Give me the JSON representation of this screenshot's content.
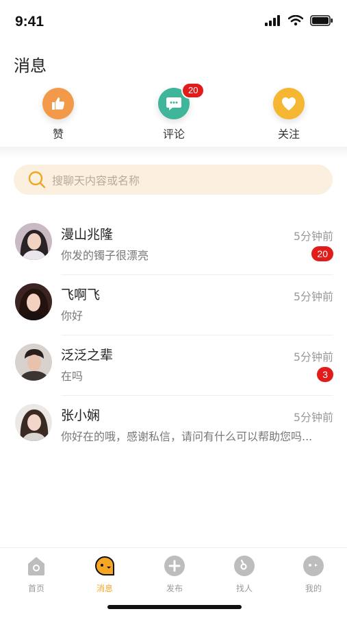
{
  "status_bar": {
    "time": "9:41"
  },
  "page": {
    "title": "消息"
  },
  "categories": [
    {
      "label": "赞",
      "icon": "thumbs-up-icon"
    },
    {
      "label": "评论",
      "icon": "comment-icon",
      "badge": "20"
    },
    {
      "label": "关注",
      "icon": "heart-icon"
    }
  ],
  "search": {
    "placeholder": "搜聊天内容或名称"
  },
  "chats": [
    {
      "name": "漫山兆隆",
      "message": "你发的镯子很漂亮",
      "time": "5分钟前",
      "unread": "20"
    },
    {
      "name": "飞啊飞",
      "message": "你好",
      "time": "5分钟前"
    },
    {
      "name": "泛泛之辈",
      "message": "在吗",
      "time": "5分钟前",
      "unread": "3"
    },
    {
      "name": "张小娴",
      "message": "你好在的哦，感谢私信，请问有什么可以帮助您吗...",
      "time": "5分钟前"
    }
  ],
  "tabbar": [
    {
      "label": "首页",
      "icon": "home-icon"
    },
    {
      "label": "消息",
      "icon": "message-icon",
      "active": true
    },
    {
      "label": "发布",
      "icon": "plus-icon"
    },
    {
      "label": "找人",
      "icon": "search-people-icon"
    },
    {
      "label": "我的",
      "icon": "profile-icon"
    }
  ],
  "colors": {
    "accent": "#f5a623",
    "badge": "#e21b1b",
    "search_bg": "#fbf0df"
  }
}
